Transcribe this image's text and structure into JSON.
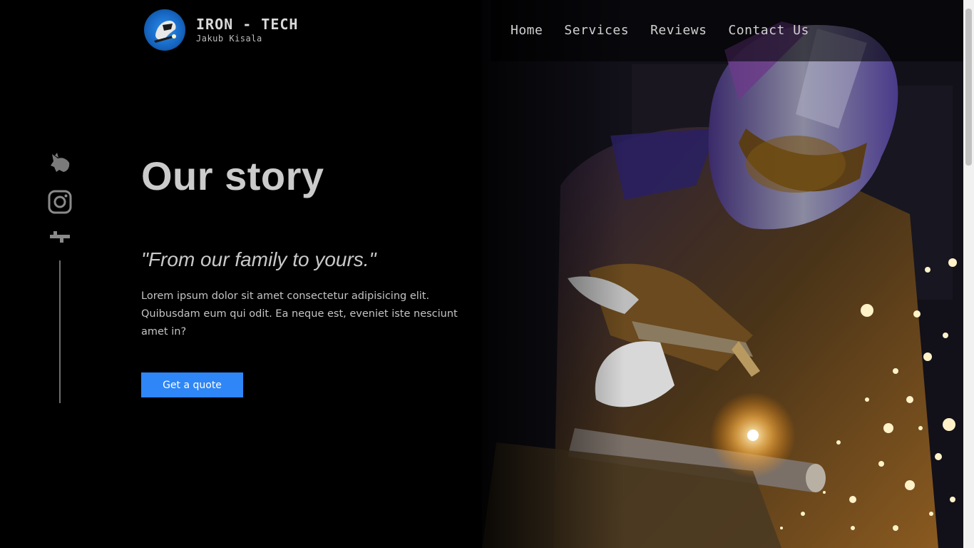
{
  "brand": {
    "title": "IRON - TECH",
    "subtitle": "Jakub Kisala",
    "logo_icon": "welder-logo-icon"
  },
  "nav": {
    "items": [
      {
        "label": "Home"
      },
      {
        "label": "Services"
      },
      {
        "label": "Reviews"
      },
      {
        "label": "Contact Us"
      }
    ]
  },
  "social": {
    "icons": [
      "wolf-icon",
      "instagram-icon",
      "brand-icon"
    ]
  },
  "hero": {
    "heading": "Our story",
    "quote": "\"From our family to yours.\"",
    "body": "Lorem ipsum dolor sit amet consectetur adipisicing elit. Quibusdam eum qui odit. Ea neque est, eveniet iste nesciunt amet in?",
    "cta_label": "Get a quote"
  },
  "colors": {
    "accent": "#2f86f6",
    "background": "#000000"
  }
}
